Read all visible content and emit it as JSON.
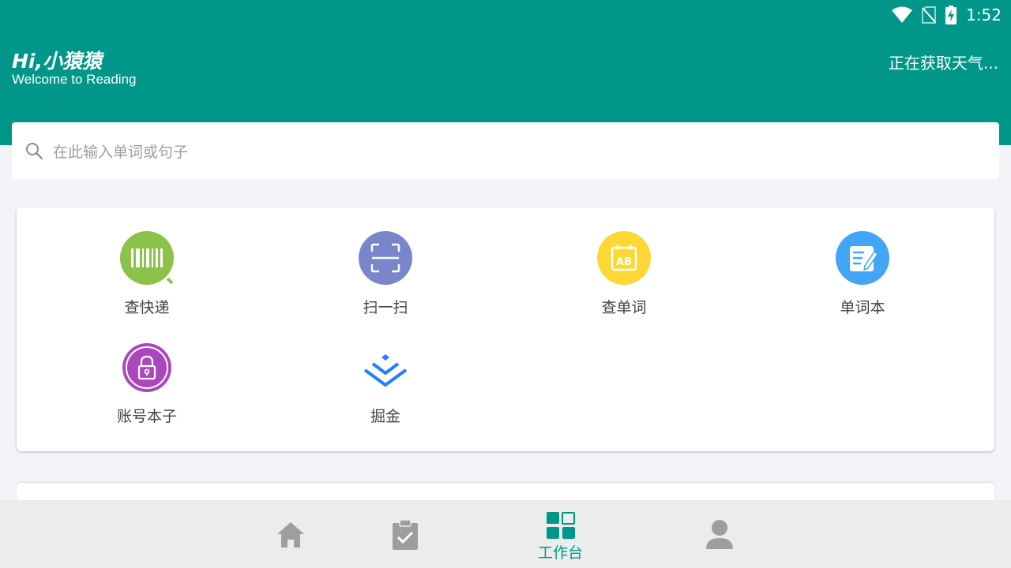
{
  "status_bar": {
    "time": "1:52"
  },
  "header": {
    "greeting": "Hi,小猿猿",
    "subtitle": "Welcome to Reading",
    "weather": "正在获取天气..."
  },
  "search": {
    "placeholder": "在此输入单词或句子"
  },
  "tools": [
    {
      "label": "查快递",
      "icon": "barcode-search-icon",
      "color": "#8bc34a"
    },
    {
      "label": "扫一扫",
      "icon": "scan-icon",
      "color": "#7986cb"
    },
    {
      "label": "查单词",
      "icon": "dictionary-calendar-icon",
      "color": "#fdd835"
    },
    {
      "label": "单词本",
      "icon": "notebook-edit-icon",
      "color": "#42a5f5"
    },
    {
      "label": "账号本子",
      "icon": "lock-icon",
      "color": "#ab47bc"
    },
    {
      "label": "掘金",
      "icon": "juejin-logo-icon",
      "color": "#1e80ff"
    }
  ],
  "bottom_nav": {
    "items": [
      {
        "name": "home",
        "icon": "home-icon"
      },
      {
        "name": "tasks",
        "icon": "clipboard-check-icon"
      },
      {
        "name": "workbench",
        "icon": "grid-icon",
        "label": "工作台",
        "active": true
      },
      {
        "name": "profile",
        "icon": "person-icon"
      }
    ]
  },
  "colors": {
    "accent": "#009688",
    "inactive_icon": "#9e9e9e"
  }
}
